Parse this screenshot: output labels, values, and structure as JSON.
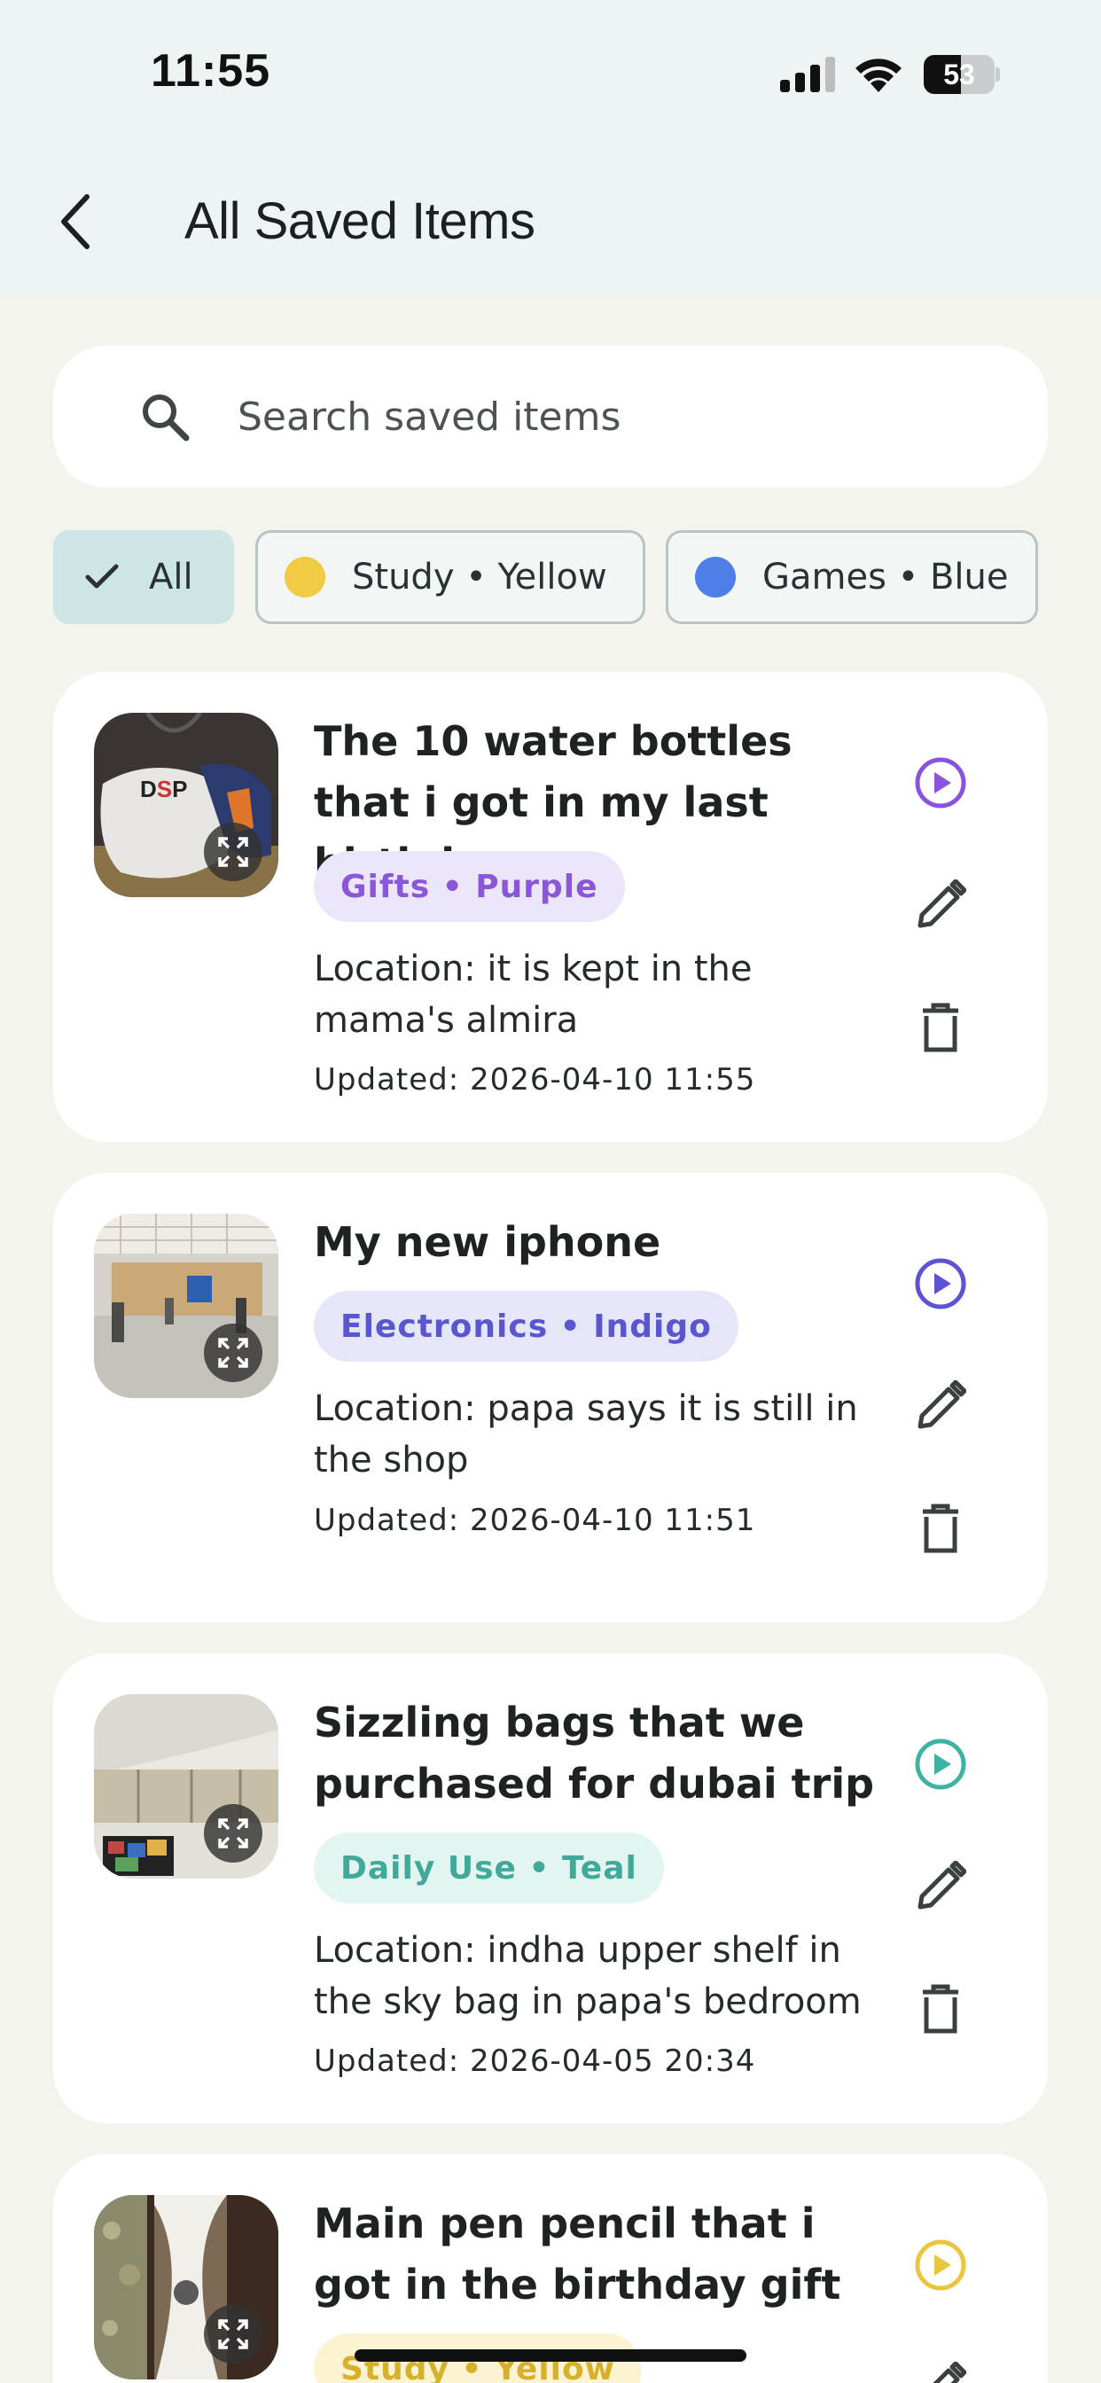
{
  "status_bar": {
    "time": "11:55",
    "battery": "53",
    "battery_level": 0.53,
    "signal_bars": 3,
    "icons": [
      "cellular-signal-icon",
      "wifi-icon",
      "battery-icon"
    ]
  },
  "header": {
    "title": "All Saved Items",
    "back_icon": "chevron-left-icon"
  },
  "search": {
    "placeholder": "Search saved items",
    "value": "",
    "icon": "search-icon"
  },
  "filters": {
    "all_label": "All",
    "chips": [
      {
        "label": "Study • Yellow",
        "color": "#f2cb45"
      },
      {
        "label": "Games • Blue",
        "color": "#4f7ee9"
      }
    ]
  },
  "items": [
    {
      "title": "The 10 water bottles that i got in my last birthday",
      "tag": "Gifts • Purple",
      "tag_color": "#8957d8",
      "tag_bg": "#ece6fa",
      "play_color": "#8a52e0",
      "location": "Location: it is kept in the mama's almira",
      "updated": "Updated: 2026-04-10 11:55"
    },
    {
      "title": "My new iphone",
      "tag": "Electronics • Indigo",
      "tag_color": "#5a56cf",
      "tag_bg": "#e6e6f9",
      "play_color": "#5c52d3",
      "location": "Location: papa says it is still in the shop",
      "updated": "Updated: 2026-04-10 11:51"
    },
    {
      "title": "Sizzling bags that we purchased for dubai trip",
      "tag": "Daily Use • Teal",
      "tag_color": "#41a99a",
      "tag_bg": "#e2f5f1",
      "play_color": "#3fb3a2",
      "location": "Location: indha upper shelf in the sky bag in papa's bedroom",
      "updated": "Updated: 2026-04-05 20:34"
    },
    {
      "title": "Main pen pencil that i got in the birthday gift",
      "tag": "Study • Yellow",
      "tag_color": "#d7b12c",
      "tag_bg": "#fbf3d2",
      "play_color": "#ecc53e",
      "location": "",
      "updated": ""
    }
  ],
  "accent_colors": {
    "app_bar_bg": "#eef3f3",
    "page_bg": "#f4f4ef",
    "selected_chip_bg": "#cde6e5"
  }
}
